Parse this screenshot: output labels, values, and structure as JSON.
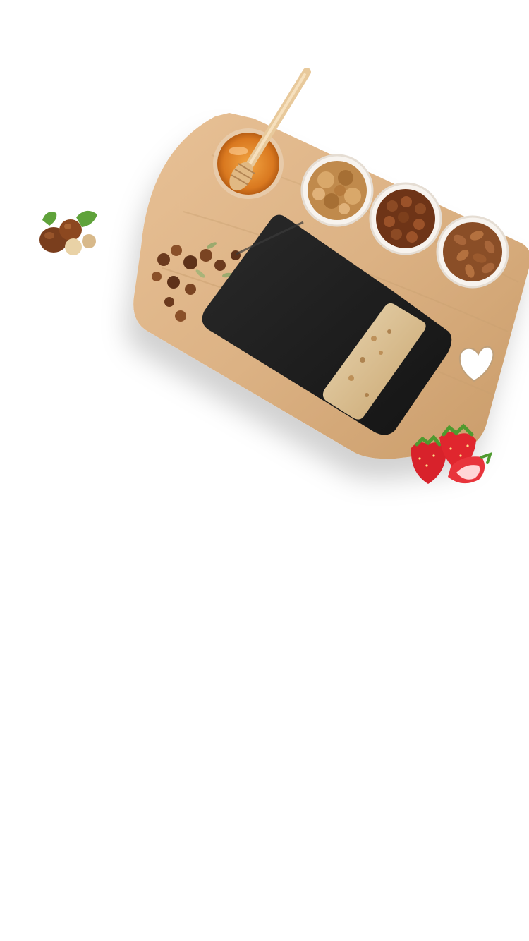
{
  "screen": {
    "background_color": "#ffffff"
  },
  "hero": {
    "image_icon": "granola-board-illustration",
    "colors": {
      "board": "#dcb284",
      "pouch": "#1c1c1c",
      "honey": "#e38a2b",
      "bowl": "#f7f3ee",
      "walnut": "#c08a4c",
      "hazelnut": "#7a3e1d",
      "almond": "#9b5a2e",
      "strawberry": "#d8222b",
      "leaf": "#5fa23a"
    }
  },
  "garnishes": {
    "left_icon": "hazelnut-icon",
    "right_icon": "strawberry-icon"
  }
}
